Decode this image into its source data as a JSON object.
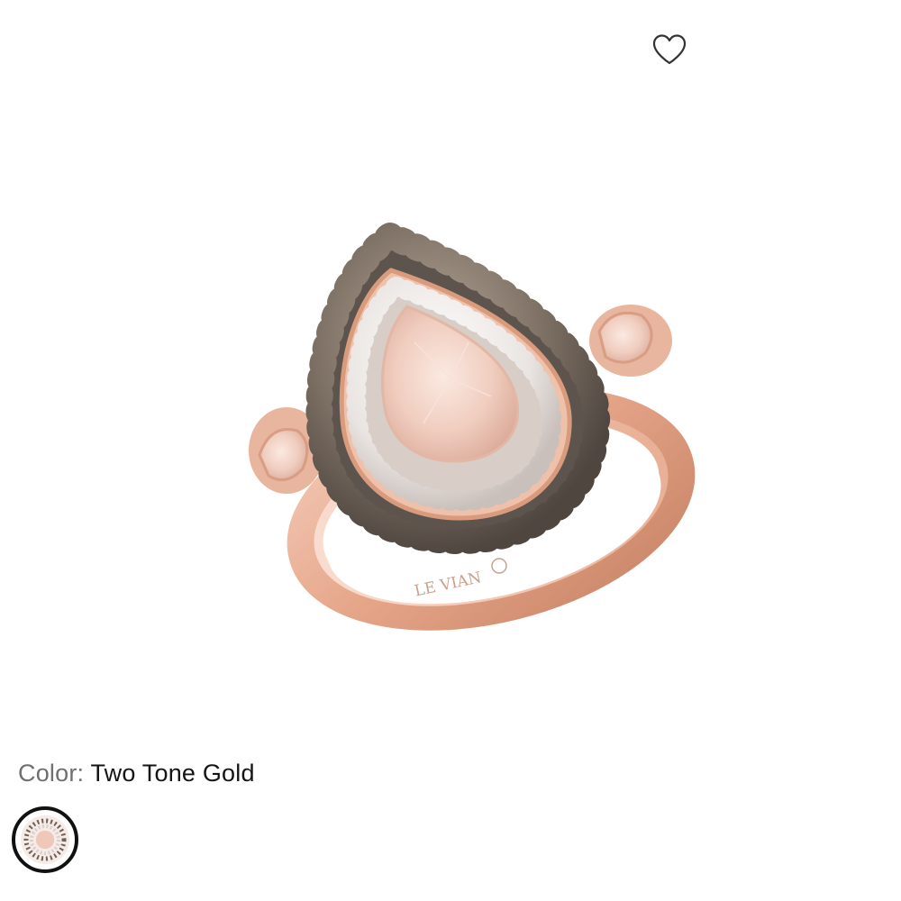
{
  "product": {
    "engraving": "LE VIAN",
    "favorite_icon": "heart-outline-icon"
  },
  "color_selector": {
    "label": "Color:",
    "value": "Two Tone Gold",
    "swatches": [
      {
        "name": "Two Tone Gold",
        "selected": true
      }
    ]
  },
  "colors": {
    "label_text": "#6f6f6f",
    "value_text": "#141414",
    "rose_gold": "#e7a98e",
    "chocolate_diamond": "#6e6359",
    "morganite": "#f1cfc2",
    "selected_ring": "#111111"
  }
}
